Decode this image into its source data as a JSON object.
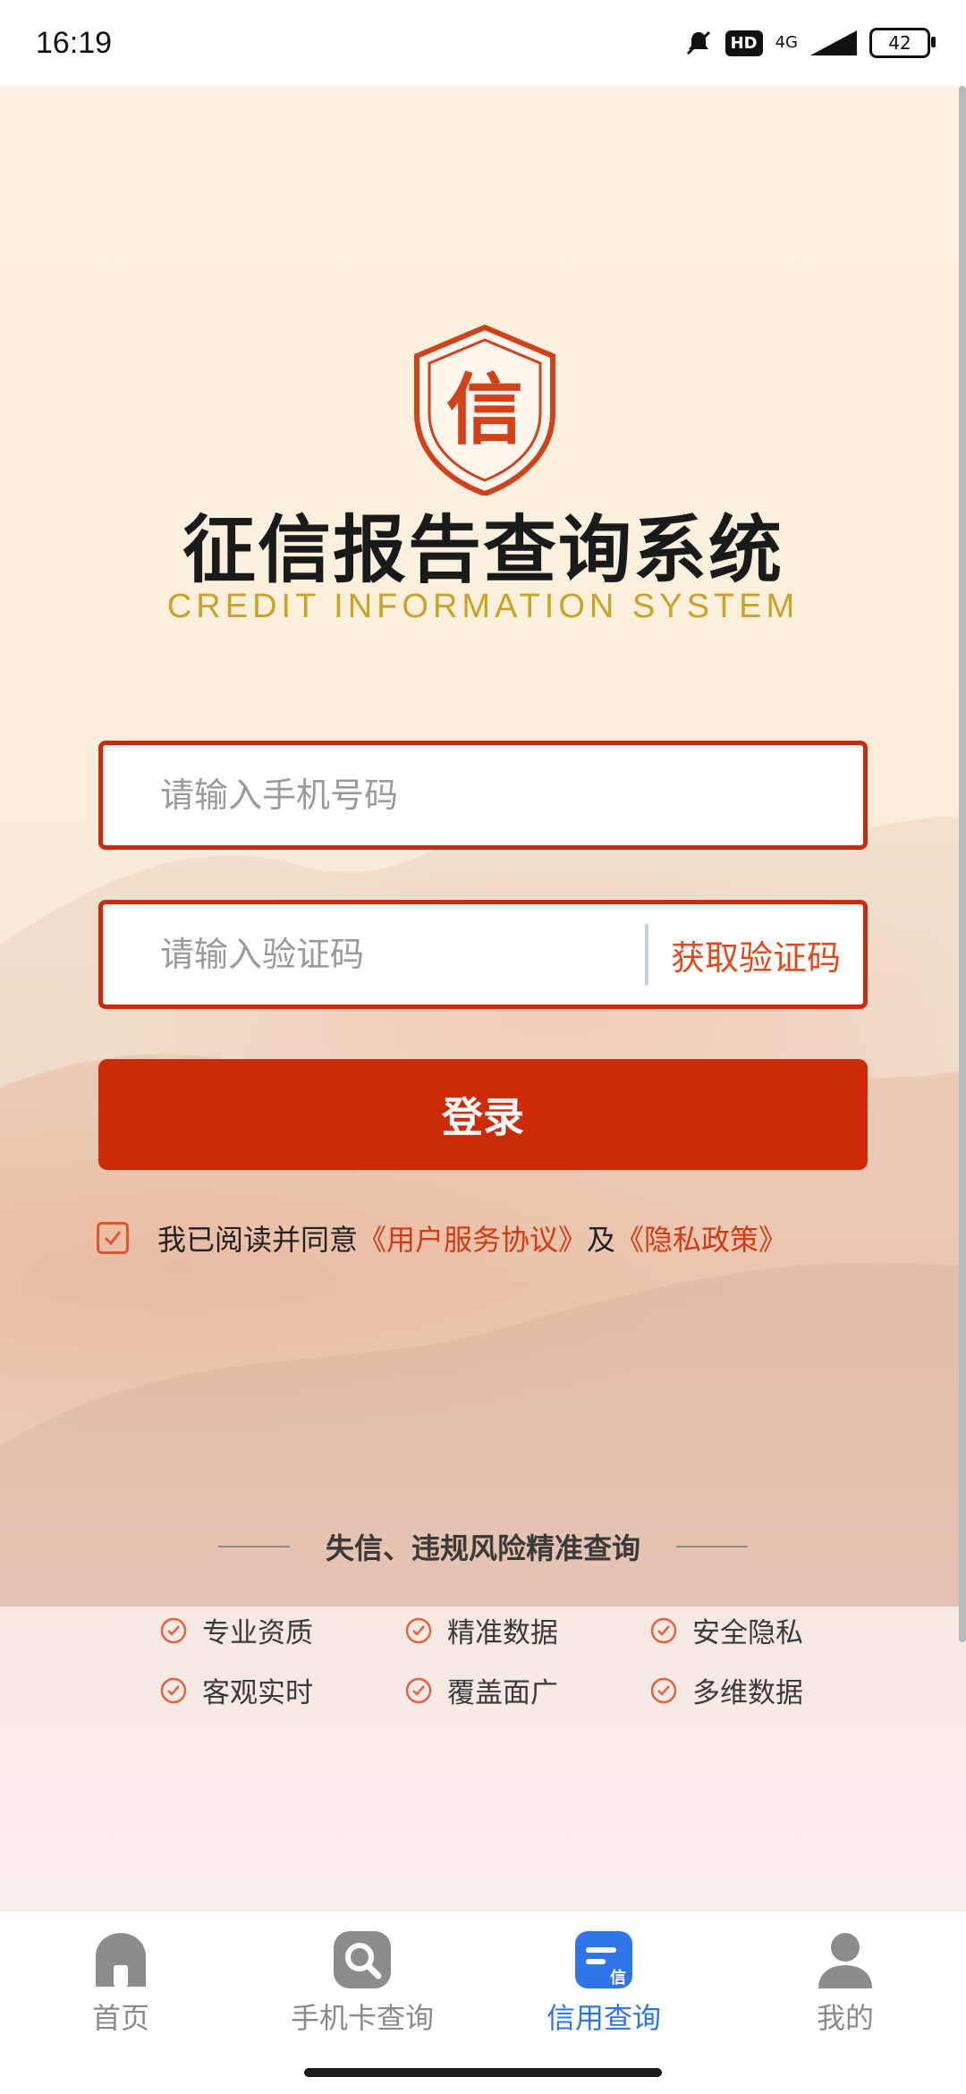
{
  "status_bar": {
    "time": "16:19",
    "hd_badge": "HD",
    "network": "4G",
    "battery": "42"
  },
  "header": {
    "logo_char": "信",
    "title": "征信报告查询系统",
    "subtitle": "CREDIT INFORMATION SYSTEM"
  },
  "form": {
    "phone_placeholder": "请输入手机号码",
    "code_placeholder": "请输入验证码",
    "get_code_label": "获取验证码",
    "login_label": "登录"
  },
  "agreement": {
    "checked": true,
    "prefix": "我已阅读并同意",
    "service_link": "《用户服务协议》",
    "conjunction": "及",
    "privacy_link": "《隐私政策》"
  },
  "features": {
    "heading": "失信、违规风险精准查询",
    "items": [
      "专业资质",
      "精准数据",
      "安全隐私",
      "客观实时",
      "覆盖面广",
      "多维数据"
    ]
  },
  "tabbar": {
    "tabs": [
      {
        "label": "首页",
        "icon": "home-icon"
      },
      {
        "label": "手机卡查询",
        "icon": "search-icon"
      },
      {
        "label": "信用查询",
        "icon": "credit-doc-icon",
        "active": true
      },
      {
        "label": "我的",
        "icon": "user-icon"
      }
    ]
  },
  "colors": {
    "brand_red": "#cd2a07",
    "gold": "#c9a227",
    "active_blue": "#2f74e8"
  }
}
